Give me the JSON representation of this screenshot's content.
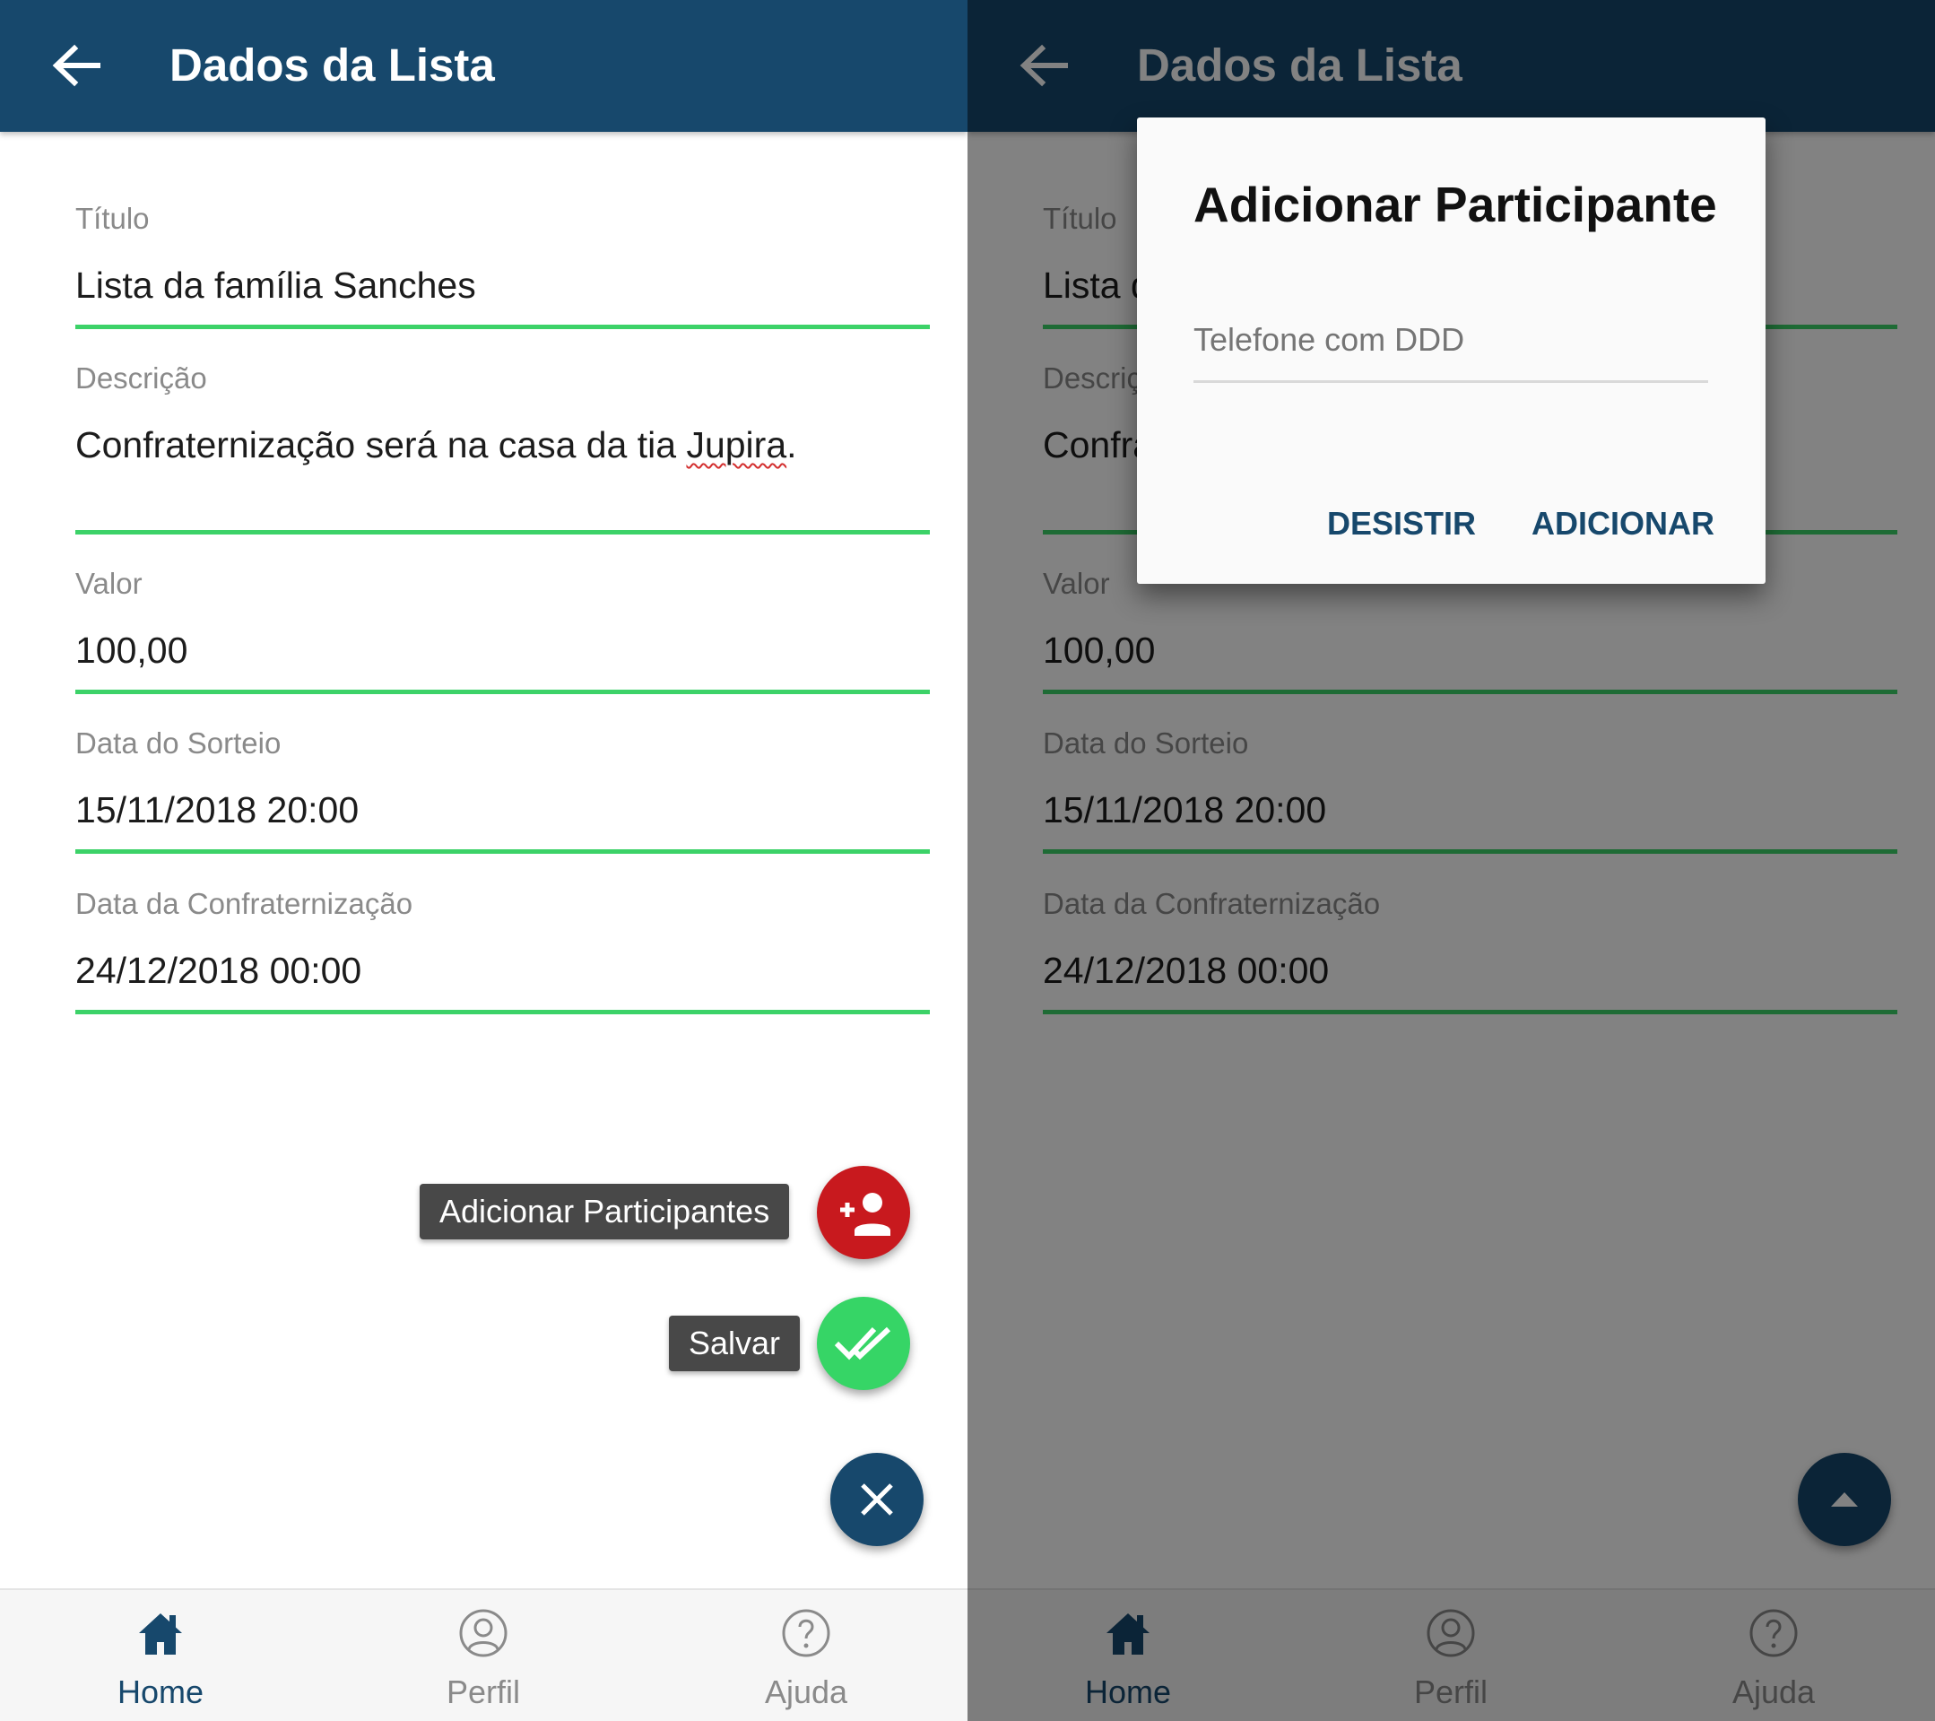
{
  "app_bar": {
    "title": "Dados da Lista"
  },
  "form": {
    "titulo": {
      "label": "Título",
      "value": "Lista da família Sanches"
    },
    "descricao": {
      "label": "Descrição",
      "value_text": "Confraternização será na casa da tia ",
      "value_misspelled": "Jupira",
      "value_end": "."
    },
    "valor": {
      "label": "Valor",
      "value": "100,00"
    },
    "data_sorteio": {
      "label": "Data do Sorteio",
      "value": "15/11/2018 20:00"
    },
    "data_confraternizacao": {
      "label": "Data da Confraternização",
      "value": "24/12/2018 00:00"
    }
  },
  "speed_dial": {
    "add_participants_label": "Adicionar Participantes",
    "save_label": "Salvar"
  },
  "bottom_nav": {
    "items": [
      {
        "label": "Home",
        "icon": "home-icon",
        "active": true
      },
      {
        "label": "Perfil",
        "icon": "profile-icon",
        "active": false
      },
      {
        "label": "Ajuda",
        "icon": "help-icon",
        "active": false
      }
    ]
  },
  "dialog": {
    "title": "Adicionar Participante",
    "input_placeholder": "Telefone com DDD",
    "cancel_label": "DESISTIR",
    "confirm_label": "ADICIONAR"
  },
  "colors": {
    "primary": "#17486c",
    "field_underline": "#3cd268",
    "fab_add": "#c8191e",
    "fab_save": "#36d566",
    "fab_close": "#17486c",
    "nav_active": "#17486c",
    "nav_inactive": "#8a8a8a"
  }
}
